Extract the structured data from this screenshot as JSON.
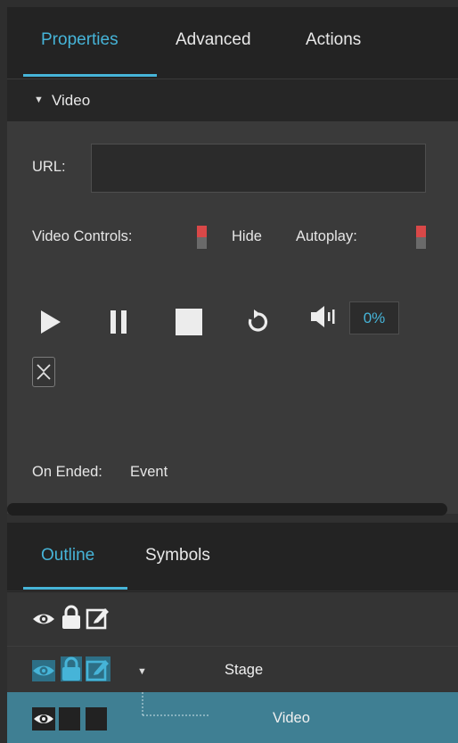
{
  "tabs": [
    {
      "label": "Properties",
      "active": true
    },
    {
      "label": "Advanced",
      "active": false
    },
    {
      "label": "Actions",
      "active": false
    }
  ],
  "section": {
    "title": "Video",
    "expanded": true
  },
  "fields": {
    "url_label": "URL:",
    "url_value": "",
    "video_controls_label": "Video Controls:",
    "hide_label": "Hide",
    "autoplay_label": "Autoplay:",
    "volume_value": "0%",
    "on_ended_label": "On Ended:",
    "on_ended_value": "Event"
  },
  "outline_tabs": [
    {
      "label": "Outline",
      "active": true
    },
    {
      "label": "Symbols",
      "active": false
    }
  ],
  "tree": [
    {
      "label": ""
    },
    {
      "label": "Stage"
    },
    {
      "label": "Video",
      "selected": true
    }
  ],
  "colors": {
    "accent": "#46b4d8",
    "toggle_on": "#d94848",
    "selected_row": "#3f7f93"
  }
}
